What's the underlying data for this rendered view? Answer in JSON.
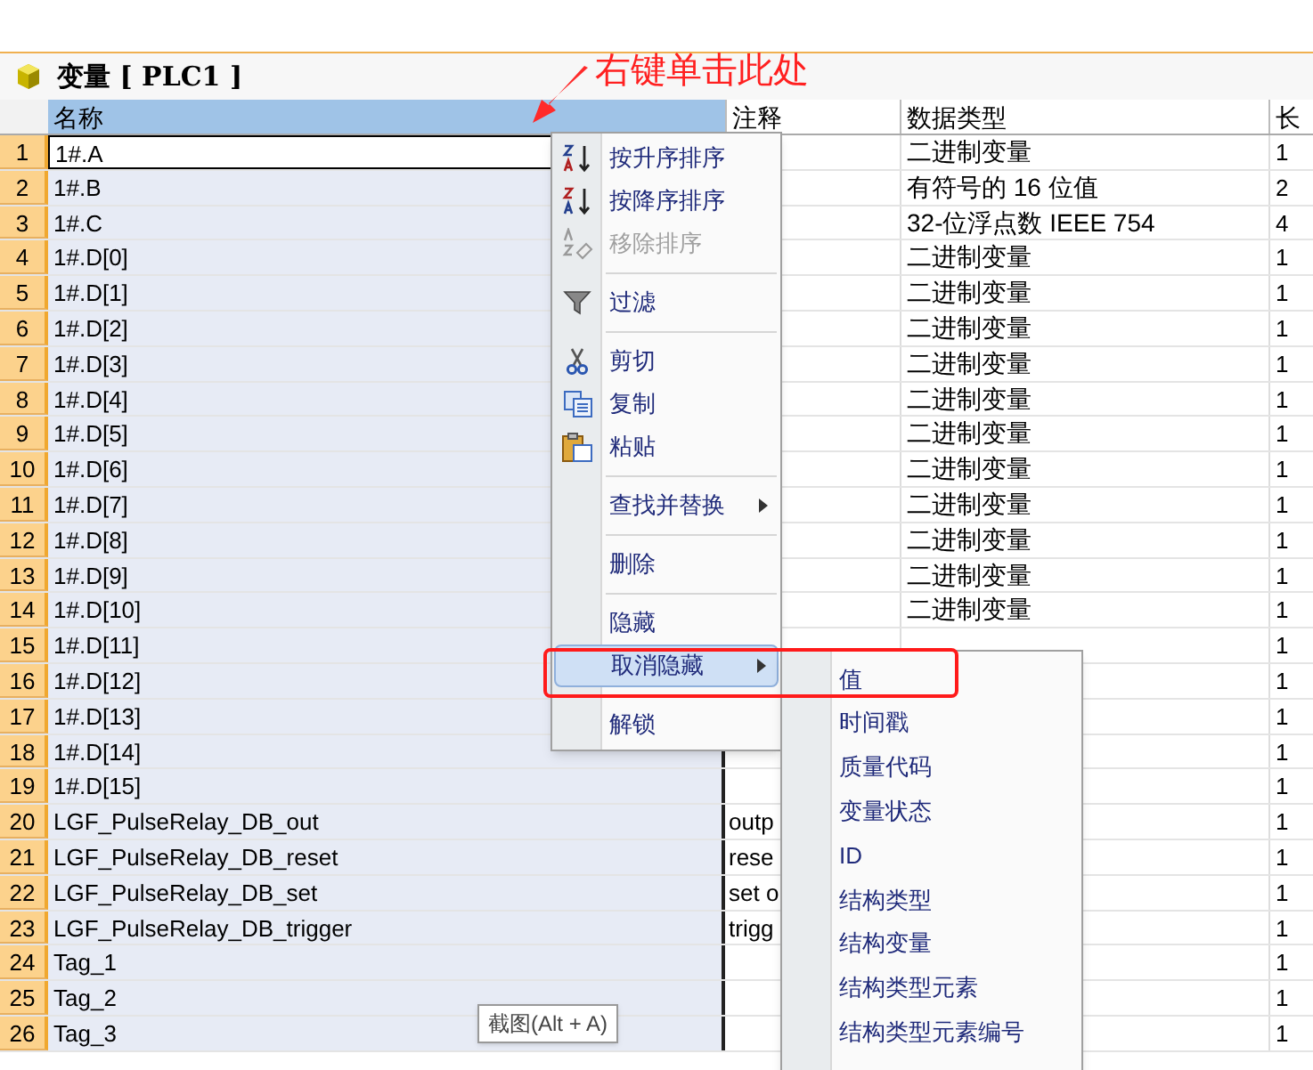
{
  "annotation": {
    "text": "右键单击此处"
  },
  "window": {
    "title": "变量 [ PLC1 ]"
  },
  "table": {
    "columns": [
      "名称",
      "注释",
      "数据类型",
      "长"
    ],
    "rows": [
      {
        "num": "1",
        "name": "1#.A",
        "type": "二进制变量",
        "length": "1",
        "selected": true
      },
      {
        "num": "2",
        "name": "1#.B",
        "type": "有符号的 16 位值",
        "length": "2",
        "selected": false
      },
      {
        "num": "3",
        "name": "1#.C",
        "type": "32-位浮点数 IEEE 754",
        "length": "4",
        "selected": false
      },
      {
        "num": "4",
        "name": "1#.D[0]",
        "type": "二进制变量",
        "length": "1",
        "selected": false
      },
      {
        "num": "5",
        "name": "1#.D[1]",
        "type": "二进制变量",
        "length": "1",
        "selected": false
      },
      {
        "num": "6",
        "name": "1#.D[2]",
        "type": "二进制变量",
        "length": "1",
        "selected": false
      },
      {
        "num": "7",
        "name": "1#.D[3]",
        "type": "二进制变量",
        "length": "1",
        "selected": false
      },
      {
        "num": "8",
        "name": "1#.D[4]",
        "type": "二进制变量",
        "length": "1",
        "selected": false
      },
      {
        "num": "9",
        "name": "1#.D[5]",
        "type": "二进制变量",
        "length": "1",
        "selected": false
      },
      {
        "num": "10",
        "name": "1#.D[6]",
        "type": "二进制变量",
        "length": "1",
        "selected": false
      },
      {
        "num": "11",
        "name": "1#.D[7]",
        "type": "二进制变量",
        "length": "1",
        "selected": false
      },
      {
        "num": "12",
        "name": "1#.D[8]",
        "type": "二进制变量",
        "length": "1",
        "selected": false
      },
      {
        "num": "13",
        "name": "1#.D[9]",
        "type": "二进制变量",
        "length": "1",
        "selected": false
      },
      {
        "num": "14",
        "name": "1#.D[10]",
        "type": "二进制变量",
        "length": "1",
        "selected": false
      },
      {
        "num": "15",
        "name": "1#.D[11]",
        "length": "1",
        "selected": false
      },
      {
        "num": "16",
        "name": "1#.D[12]",
        "length": "1",
        "selected": false
      },
      {
        "num": "17",
        "name": "1#.D[13]",
        "length": "1",
        "selected": false
      },
      {
        "num": "18",
        "name": "1#.D[14]",
        "length": "1",
        "selected": false
      },
      {
        "num": "19",
        "name": "1#.D[15]",
        "length": "1",
        "selected": false
      },
      {
        "num": "20",
        "name": "LGF_PulseRelay_DB_out",
        "comment": "outp",
        "length": "1",
        "selected": false
      },
      {
        "num": "21",
        "name": "LGF_PulseRelay_DB_reset",
        "comment": "rese",
        "length": "1",
        "selected": false
      },
      {
        "num": "22",
        "name": "LGF_PulseRelay_DB_set",
        "comment": "set o",
        "length": "1",
        "selected": false
      },
      {
        "num": "23",
        "name": "LGF_PulseRelay_DB_trigger",
        "comment": "trigg",
        "length": "1",
        "selected": false
      },
      {
        "num": "24",
        "name": "Tag_1",
        "length": "1",
        "selected": false
      },
      {
        "num": "25",
        "name": "Tag_2",
        "length": "1",
        "selected": false
      },
      {
        "num": "26",
        "name": "Tag_3",
        "length": "1",
        "selected": false
      }
    ]
  },
  "context_menu": {
    "items": [
      {
        "kind": "item",
        "label": "按升序排序",
        "disabled": false,
        "selected": false,
        "submenu": false
      },
      {
        "kind": "item",
        "label": "按降序排序",
        "disabled": false,
        "selected": false,
        "submenu": false
      },
      {
        "kind": "item",
        "label": "移除排序",
        "disabled": true,
        "selected": false,
        "submenu": false
      },
      {
        "kind": "separator"
      },
      {
        "kind": "item",
        "label": "过滤",
        "disabled": false,
        "selected": false,
        "submenu": false
      },
      {
        "kind": "separator"
      },
      {
        "kind": "item",
        "label": "剪切",
        "disabled": false,
        "selected": false,
        "submenu": false
      },
      {
        "kind": "item",
        "label": "复制",
        "disabled": false,
        "selected": false,
        "submenu": false
      },
      {
        "kind": "item",
        "label": "粘贴",
        "disabled": false,
        "selected": false,
        "submenu": false
      },
      {
        "kind": "separator"
      },
      {
        "kind": "item",
        "label": "查找并替换",
        "disabled": false,
        "selected": false,
        "submenu": true
      },
      {
        "kind": "separator"
      },
      {
        "kind": "item",
        "label": "删除",
        "disabled": false,
        "selected": false,
        "submenu": false
      },
      {
        "kind": "separator"
      },
      {
        "kind": "item",
        "label": "隐藏",
        "disabled": false,
        "selected": false,
        "submenu": false
      },
      {
        "kind": "item",
        "label": "取消隐藏",
        "disabled": false,
        "selected": true,
        "submenu": true
      },
      {
        "kind": "separator"
      },
      {
        "kind": "item",
        "label": "解锁",
        "disabled": false,
        "selected": false,
        "submenu": false
      }
    ]
  },
  "submenu": {
    "items": [
      "值",
      "时间戳",
      "质量代码",
      "变量状态",
      "ID",
      "结构类型",
      "结构变量",
      "结构类型元素",
      "结构类型元素编号"
    ]
  },
  "tooltip": {
    "text": "截图(Alt + A)"
  }
}
